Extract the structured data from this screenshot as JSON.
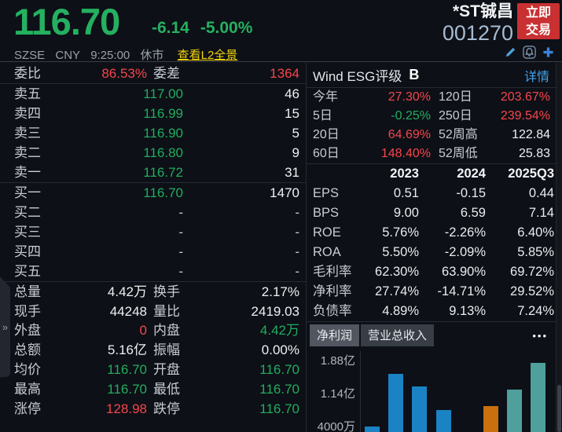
{
  "colors": {
    "up_red": "#f4464d",
    "down_green": "#21ad60",
    "link_yellow": "#f2d30d",
    "link_blue": "#46a1e8",
    "code_blue": "#a6bbd1",
    "button_red": "#c93032",
    "bar_blue": "#1b82c4",
    "bar_orange": "#c9700f",
    "bar_teal": "#4fa09d"
  },
  "header": {
    "price": "116.70",
    "change": "-6.14",
    "change_pct": "-5.00%",
    "exchange": "SZSE",
    "currency": "CNY",
    "time": "9:25:00",
    "status": "休市",
    "l2_link": "查看L2全景",
    "stock_name": "*ST铖昌",
    "stock_code": "001270",
    "trade_button_line1": "立即",
    "trade_button_line2": "交易"
  },
  "order_panel": {
    "ratio_row": {
      "label1": "委比",
      "value1": "86.53%",
      "label2": "委差",
      "value2": "1364"
    },
    "asks": [
      {
        "label": "卖五",
        "price": "117.00",
        "volume": "46"
      },
      {
        "label": "卖四",
        "price": "116.99",
        "volume": "15"
      },
      {
        "label": "卖三",
        "price": "116.90",
        "volume": "5"
      },
      {
        "label": "卖二",
        "price": "116.80",
        "volume": "9"
      },
      {
        "label": "卖一",
        "price": "116.72",
        "volume": "31"
      }
    ],
    "bids": [
      {
        "label": "买一",
        "price": "116.70",
        "volume": "1470",
        "pc": "green",
        "vc": "white"
      },
      {
        "label": "买二",
        "price": "-",
        "volume": "-",
        "pc": "dim",
        "vc": "dim"
      },
      {
        "label": "买三",
        "price": "-",
        "volume": "-",
        "pc": "dim",
        "vc": "dim"
      },
      {
        "label": "买四",
        "price": "-",
        "volume": "-",
        "pc": "dim",
        "vc": "dim"
      },
      {
        "label": "买五",
        "price": "-",
        "volume": "-",
        "pc": "dim",
        "vc": "dim"
      }
    ],
    "stats": [
      {
        "label1": "总量",
        "value1": "4.42万",
        "c1": "white",
        "label2": "换手",
        "value2": "2.17%",
        "c2": "white"
      },
      {
        "label1": "现手",
        "value1": "44248",
        "c1": "white",
        "label2": "量比",
        "value2": "2419.03",
        "c2": "white"
      },
      {
        "label1": "外盘",
        "value1": "0",
        "c1": "red",
        "label2": "内盘",
        "value2": "4.42万",
        "c2": "green"
      },
      {
        "label1": "总额",
        "value1": "5.16亿",
        "c1": "white",
        "label2": "振幅",
        "value2": "0.00%",
        "c2": "white"
      },
      {
        "label1": "均价",
        "value1": "116.70",
        "c1": "green",
        "label2": "开盘",
        "value2": "116.70",
        "c2": "green"
      },
      {
        "label1": "最高",
        "value1": "116.70",
        "c1": "green",
        "label2": "最低",
        "value2": "116.70",
        "c2": "green"
      },
      {
        "label1": "涨停",
        "value1": "128.98",
        "c1": "red",
        "label2": "跌停",
        "value2": "116.70",
        "c2": "green"
      }
    ],
    "expander_glyph": "»"
  },
  "right_panel": {
    "esg": {
      "label": "Wind ESG评级",
      "rating": "B",
      "detail_link": "详情"
    },
    "performance": [
      {
        "label1": "今年",
        "value1": "27.30%",
        "c1": "red",
        "label2": "120日",
        "value2": "203.67%",
        "c2": "red"
      },
      {
        "label1": "5日",
        "value1": "-0.25%",
        "c1": "green",
        "label2": "250日",
        "value2": "239.54%",
        "c2": "red"
      },
      {
        "label1": "20日",
        "value1": "64.69%",
        "c1": "red",
        "label2": "52周高",
        "value2": "122.84",
        "c2": "white"
      },
      {
        "label1": "60日",
        "value1": "148.40%",
        "c1": "red",
        "label2": "52周低",
        "value2": "25.83",
        "c2": "white"
      }
    ],
    "financials": {
      "col1": "2023",
      "col2": "2024",
      "col3": "2025Q3",
      "rows": [
        {
          "label": "EPS",
          "v1": "0.51",
          "v2": "-0.15",
          "v3": "0.44"
        },
        {
          "label": "BPS",
          "v1": "9.00",
          "v2": "6.59",
          "v3": "7.14"
        },
        {
          "label": "ROE",
          "v1": "5.76%",
          "v2": "-2.26%",
          "v3": "6.40%"
        },
        {
          "label": "ROA",
          "v1": "5.50%",
          "v2": "-2.09%",
          "v3": "5.85%"
        },
        {
          "label": "毛利率",
          "v1": "62.30%",
          "v2": "63.90%",
          "v3": "69.72%"
        },
        {
          "label": "净利率",
          "v1": "27.74%",
          "v2": "-14.71%",
          "v3": "29.52%"
        },
        {
          "label": "负债率",
          "v1": "4.89%",
          "v2": "9.13%",
          "v3": "7.24%"
        }
      ]
    },
    "chart_tabs": [
      {
        "label": "净利润",
        "cls": "tab-active"
      },
      {
        "label": "营业总收入",
        "cls": "tab-idle"
      }
    ],
    "more_glyph": "•••"
  },
  "chart_data": {
    "type": "bar",
    "title": "净利润",
    "unit": "亿",
    "legend_position": "none",
    "grid": false,
    "ylim_visible": [
      0.4,
      1.95
    ],
    "y_ticks": [
      {
        "label": "1.88亿",
        "value": 1.88
      },
      {
        "label": "1.14亿",
        "value": 1.14
      },
      {
        "label": "4000万",
        "value": 0.4
      }
    ],
    "series": [
      {
        "name": "净利润",
        "bars": [
          {
            "value": 0.42,
            "color": "#1b82c4"
          },
          {
            "value": 1.59,
            "color": "#1b82c4"
          },
          {
            "value": 1.31,
            "color": "#1b82c4"
          },
          {
            "value": 0.78,
            "color": "#1b82c4"
          },
          {
            "value": null,
            "color": null
          },
          {
            "value": 0.88,
            "color": "#c9700f"
          },
          {
            "value": 1.24,
            "color": "#4fa09d"
          },
          {
            "value": 1.85,
            "color": "#4fa09d"
          }
        ]
      }
    ]
  }
}
